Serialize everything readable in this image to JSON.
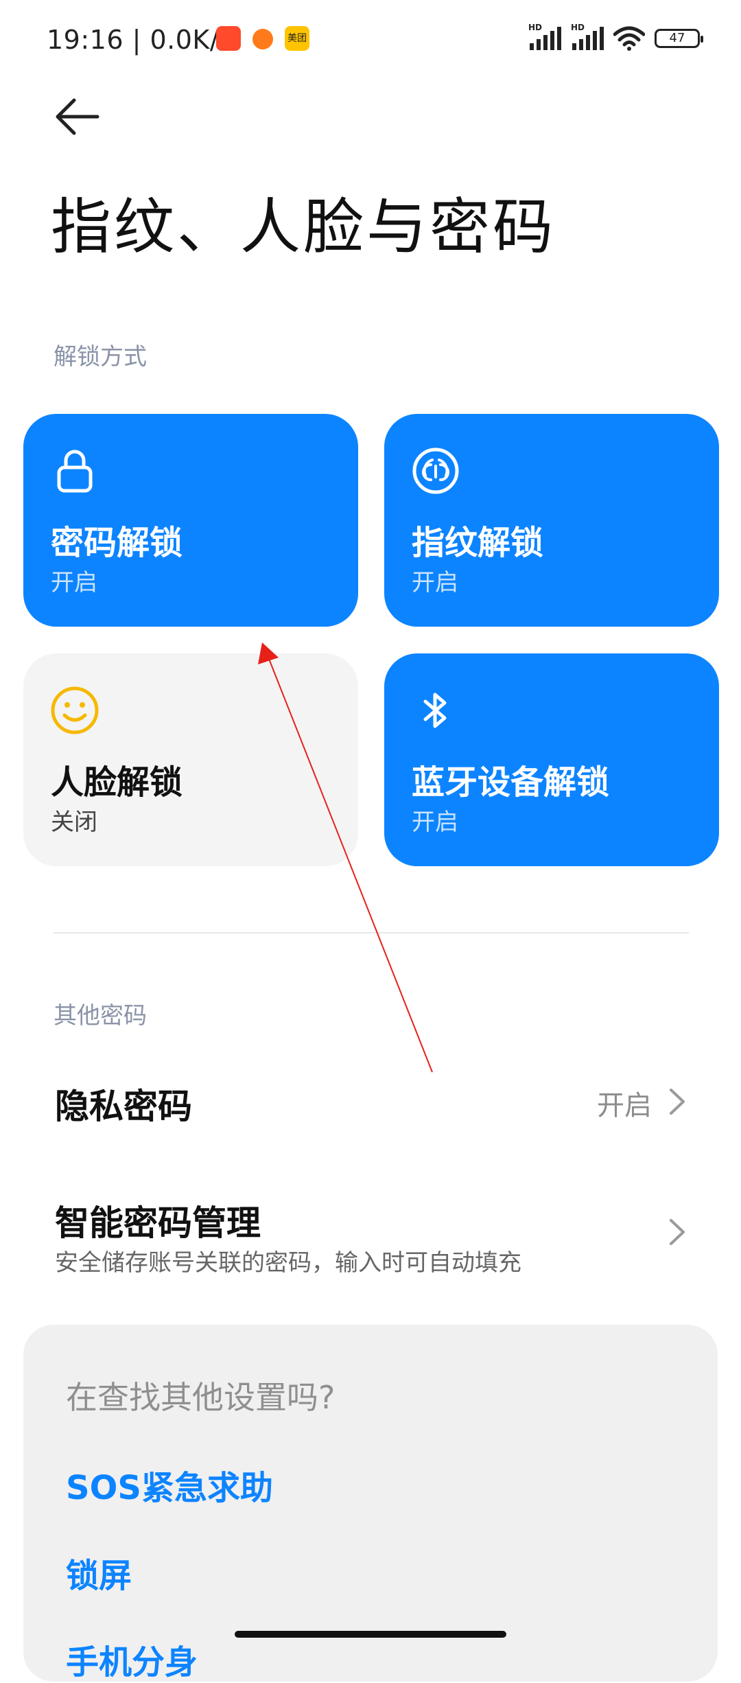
{
  "status": {
    "time": "19:16",
    "net_speed": "0.0K/s",
    "app_icons": [
      "taobao-icon",
      "orange-app-icon",
      "meituan-icon"
    ],
    "meituan_label": "美团",
    "signal_labels": [
      "HD",
      "HD"
    ],
    "battery": "47"
  },
  "header": {
    "title": "指纹、人脸与密码"
  },
  "unlock": {
    "section_label": "解锁方式",
    "tiles": [
      {
        "title": "密码解锁",
        "status": "开启",
        "icon": "lock-icon",
        "enabled": true
      },
      {
        "title": "指纹解锁",
        "status": "开启",
        "icon": "fingerprint-icon",
        "enabled": true
      },
      {
        "title": "人脸解锁",
        "status": "关闭",
        "icon": "smiley-face-icon",
        "enabled": false
      },
      {
        "title": "蓝牙设备解锁",
        "status": "开启",
        "icon": "bluetooth-icon",
        "enabled": true
      }
    ]
  },
  "other": {
    "section_label": "其他密码",
    "privacy": {
      "title": "隐私密码",
      "value": "开启"
    },
    "smart": {
      "title": "智能密码管理",
      "subtitle": "安全储存账号关联的密码，输入时可自动填充"
    }
  },
  "suggest": {
    "question": "在查找其他设置吗?",
    "links": [
      "SOS紧急求助",
      "锁屏",
      "手机分身"
    ]
  },
  "colors": {
    "accent": "#0d84ff",
    "tile_off": "#f4f4f4",
    "face_icon": "#f5b800",
    "annotation_arrow": "#e8201a"
  }
}
